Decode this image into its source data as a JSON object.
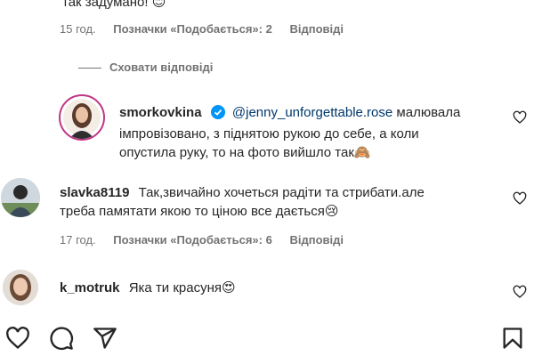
{
  "top_comment": {
    "text_fragment": "так задумано!",
    "emoji": "😊",
    "time": "15 год.",
    "likes": "Позначки «Подобається»: 2",
    "reply": "Відповіді"
  },
  "hide_replies": "Сховати відповіді",
  "reply_comment": {
    "username": "smorkovkina",
    "mention": "@jenny_unforgettable.rose",
    "text_line1": "малювала",
    "text_line2": "імпровізовано, з піднятою рукою до себе, а коли",
    "text_line3": "опустила руку, то на фото вийшло так",
    "emoji": "🙈"
  },
  "comment_slavka": {
    "username": "slavka8119",
    "text_line1": "Так,звичайно хочеться радіти та стрибати.але",
    "text_line2": "треба памятати якою то ціною все дається",
    "emoji": "😢",
    "time": "17 год.",
    "likes": "Позначки «Подобається»: 6",
    "reply": "Відповіді"
  },
  "comment_motruk": {
    "username": "k_motruk",
    "text": "Яка ти красуня",
    "emoji": "😍"
  },
  "colors": {
    "verified": "#0095f6",
    "mention": "#00376b",
    "muted": "#737373"
  },
  "icons": [
    "heart-icon",
    "comment-icon",
    "share-icon",
    "bookmark-icon",
    "verified-badge-icon"
  ]
}
